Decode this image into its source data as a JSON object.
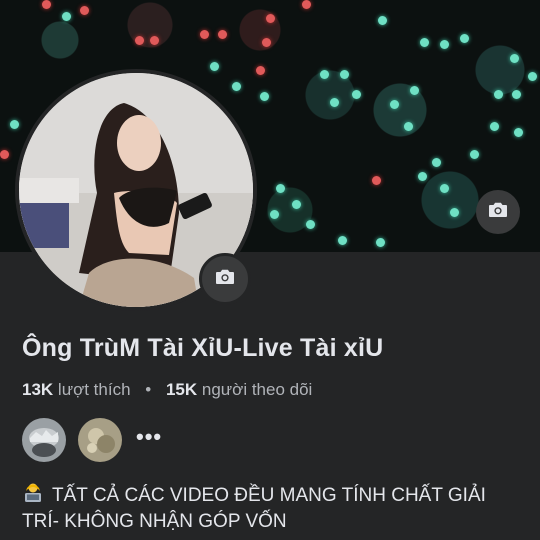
{
  "profile": {
    "name": "Ông TrùM Tài XỉU-Live Tài xỉU",
    "likes_count": "13K",
    "likes_label": "lượt thích",
    "separator": "•",
    "followers_count": "15K",
    "followers_label": "người theo dõi",
    "more_label": "•••",
    "bio": "TẤT CẢ CÁC VIDEO ĐỀU MANG TÍNH CHẤT GIẢI TRÍ- KHÔNG NHẬN GÓP VỐN"
  },
  "icons": {
    "cover_camera": "camera-icon",
    "avatar_camera": "camera-icon",
    "bio_icon": "person-laptop-icon"
  },
  "colors": {
    "background": "#242526",
    "text_primary": "#e4e6eb",
    "text_secondary": "#b0b3b8",
    "button_bg": "#3a3b3c"
  }
}
